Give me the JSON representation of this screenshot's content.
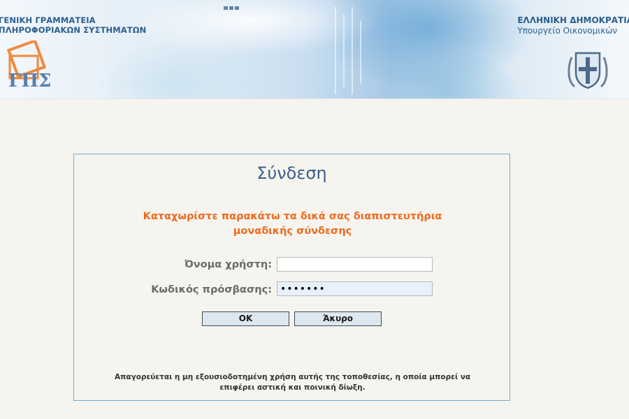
{
  "header": {
    "left_line1": "ΓΕΝΙΚΗ ΓΡΑΜΜΑΤΕΙΑ",
    "left_line2": "ΠΛΗΡΟΦΟΡΙΑΚΩΝ ΣΥΣΤΗΜΑΤΩΝ",
    "right_line1": "ΕΛΛΗΝΙΚΗ ΔΗΜΟΚΡΑΤΙΑ",
    "right_line2": "Υπουργείο Οικονομικών",
    "logo_left_icon": "gsis-logo-icon",
    "logo_right_icon": "greek-coat-of-arms-icon"
  },
  "login": {
    "title": "Σύνδεση",
    "instructions_line1": "Καταχωρίστε παρακάτω τα δικά σας διαπιστευτήρια",
    "instructions_line2": "μοναδικής σύνδεσης",
    "username_label": "Όνομα χρήστη:",
    "username_value": "",
    "password_label": "Κωδικός πρόσβασης:",
    "password_value": "•••••••",
    "ok_button": "OK",
    "cancel_button": "Άκυρο",
    "disclaimer_line1": "Απαγορεύεται η μη εξουσιοδοτημένη χρήση αυτής της τοποθεσίας, η οποία μπορεί να",
    "disclaimer_line2": "επιφέρει αστική και ποινική δίωξη."
  },
  "colors": {
    "title": "#3a5f8a",
    "instructions": "#ee6a1c",
    "box_border": "#77aacc",
    "header_text": "#2b5f8f"
  }
}
